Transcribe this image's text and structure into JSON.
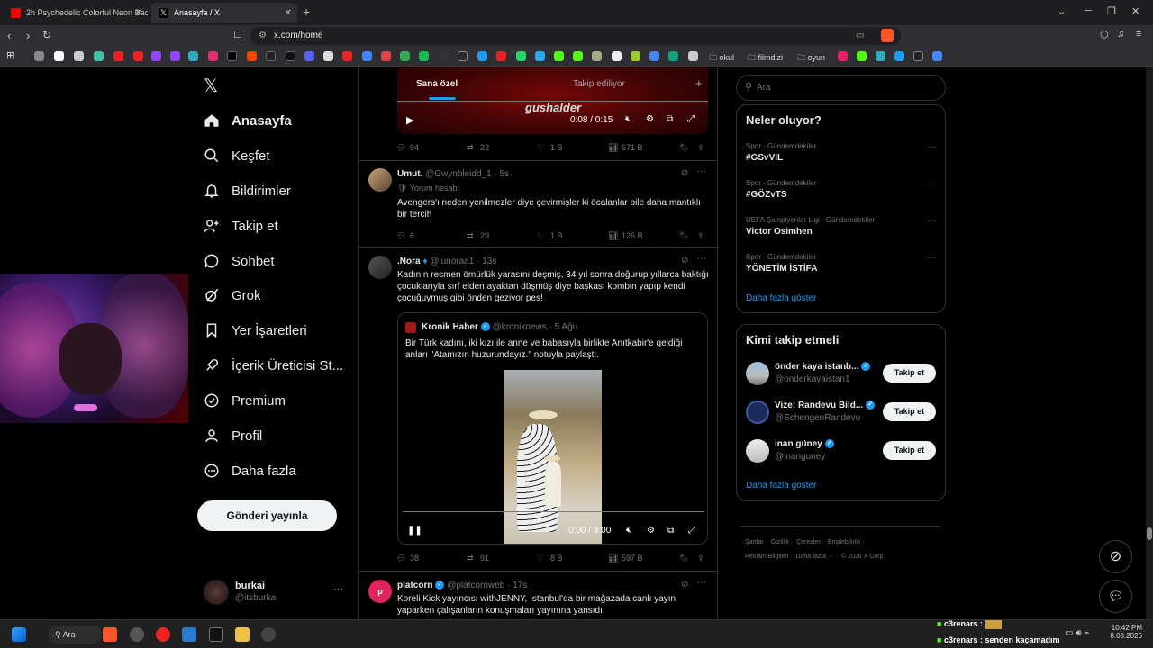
{
  "browser": {
    "tabs": [
      {
        "title": "2h Psychedelic Colorful Neon Backgr",
        "active": false
      },
      {
        "title": "Anasayfa / X",
        "active": true
      }
    ],
    "url": "x.com/home",
    "bookmarks": {
      "folder1": "okul",
      "folder2": "filmdizi",
      "folder3": "oyun"
    },
    "brave_badge": "2"
  },
  "sidebar": {
    "items": [
      {
        "label": "Anasayfa",
        "icon": "home-icon"
      },
      {
        "label": "Keşfet",
        "icon": "search-icon"
      },
      {
        "label": "Bildirimler",
        "icon": "bell-icon"
      },
      {
        "label": "Takip et",
        "icon": "person-plus-icon"
      },
      {
        "label": "Sohbet",
        "icon": "chat-icon"
      },
      {
        "label": "Grok",
        "icon": "grok-icon"
      },
      {
        "label": "Yer İşaretleri",
        "icon": "bookmark-icon"
      },
      {
        "label": "İçerik Üreticisi St...",
        "icon": "rocket-icon"
      },
      {
        "label": "Premium",
        "icon": "verified-icon"
      },
      {
        "label": "Profil",
        "icon": "person-icon"
      },
      {
        "label": "Daha fazla",
        "icon": "more-circle-icon"
      }
    ],
    "post_button": "Gönderi yayınla",
    "account": {
      "name": "burkai",
      "handle": "@itsburkai"
    }
  },
  "feed": {
    "tabs": [
      "Sana özel",
      "Takip ediliyor"
    ],
    "top_video": {
      "watermark": "gushalder",
      "time": "0:08 / 0:15"
    },
    "top_actions": {
      "replies": "94",
      "reposts": "22",
      "likes": "1 B",
      "views": "671 B"
    },
    "posts": [
      {
        "name": "Umut.",
        "handle": "@Gwynbleidd_1",
        "time": "5s",
        "reply_label": "Yorum hesabı",
        "text": "Avengers'ı neden yenilmezler diye çevirmişler ki öcalanlar bile daha mantıklı bir tercih",
        "replies": "6",
        "reposts": "29",
        "likes": "1 B",
        "views": "126 B"
      },
      {
        "name": ".Nora",
        "handle": "@lunoraa1",
        "time": "13s",
        "text": "Kadının resmen ömürlük yarasını deşmiş, 34 yıl sonra doğurup yıllarca baktığı çocuklarıyla sırf elden ayaktan düşmüş diye başkası kombin yapıp kendi çocuğuymuş gibi önden geziyor pes!",
        "quote": {
          "name": "Kronik Haber",
          "handle": "@kroniknews",
          "time": "5 Ağu",
          "text": "Bir Türk kadını, iki kızı ile anne ve babasıyla birlikte Anıtkabir'e geldiği anları \"Atamızın huzurundayız.\" notuyla paylaştı.",
          "video_time": "0:00 / 3:00"
        },
        "replies": "38",
        "reposts": "91",
        "likes": "8 B",
        "views": "597 B"
      },
      {
        "name": "platcorn",
        "handle": "@platcornweb",
        "time": "17s",
        "text": "Koreli Kick yayıncısı withJENNY, İstanbul'da bir mağazada canlı yayın yaparken çalışanların konuşmaları yayınına yansıdı."
      }
    ]
  },
  "right": {
    "search_placeholder": "Ara",
    "trends_title": "Neler oluyor?",
    "trends": [
      {
        "category": "Spor · Gündemdekiler",
        "name": "#GSvVIL"
      },
      {
        "category": "Spor · Gündemdekiler",
        "name": "#GÖZvTS"
      },
      {
        "category": "UEFA Şampiyonlar Ligi · Gündemdekiler",
        "name": "Victor Osimhen"
      },
      {
        "category": "Spor · Gündemdekiler",
        "name": "YÖNETİM İSTİFA"
      }
    ],
    "show_more": "Daha fazla göster",
    "who_title": "Kimi takip etmeli",
    "who": [
      {
        "name": "önder kaya istanb...",
        "handle": "@onderkayaistan1",
        "button": "Takip et"
      },
      {
        "name": "Vize: Randevu Bild...",
        "handle": "@SchengenRandevu",
        "button": "Takip et"
      },
      {
        "name": "inan güney",
        "handle": "@inanguney",
        "button": "Takip et"
      }
    ],
    "who_more": "Daha fazla göster",
    "footer": [
      "Şartlar",
      "Gizlilik",
      "Çerezler",
      "Erişilebilirlik",
      "Reklam Bilgileri",
      "Daha fazla ···",
      "© 2026 X Corp."
    ]
  },
  "taskbar": {
    "search": "Ara",
    "chat1": "c3renars :",
    "chat2": "c3renars : senden kaçamadım",
    "time": "10:42 PM",
    "date": "8.08.2026"
  },
  "colors": {
    "accent": "#1d9bf0",
    "background": "#000000",
    "border": "#2f3336"
  }
}
